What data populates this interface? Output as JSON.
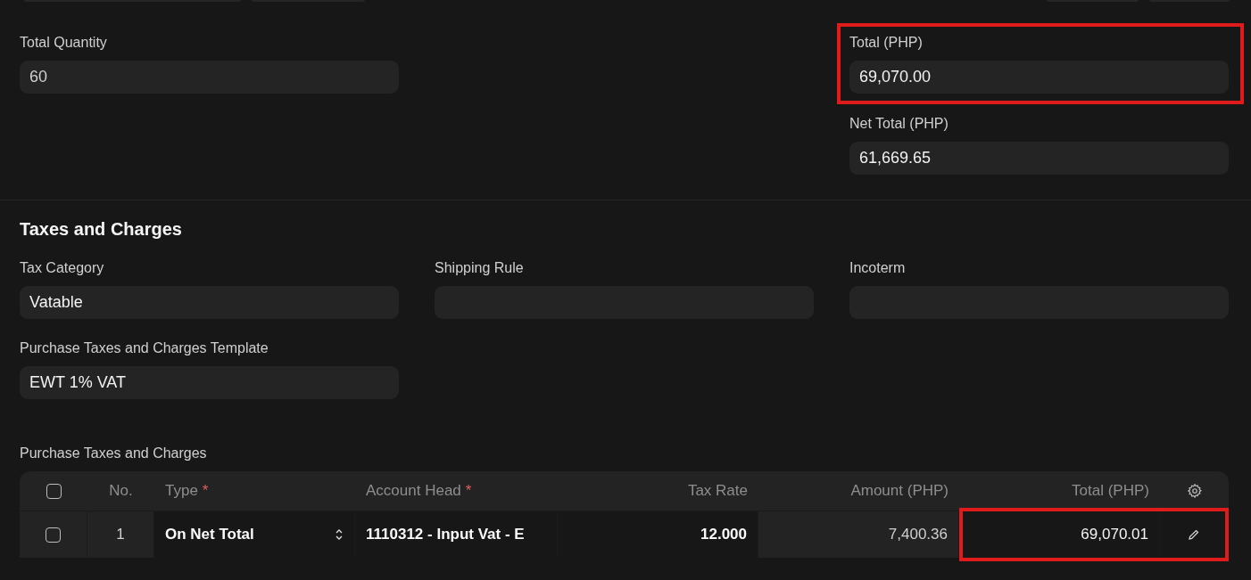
{
  "summary": {
    "total_quantity": {
      "label": "Total Quantity",
      "value": "60"
    },
    "total": {
      "label": "Total (PHP)",
      "value": "69,070.00",
      "highlighted": true
    },
    "net_total": {
      "label": "Net Total (PHP)",
      "value": "61,669.65"
    }
  },
  "taxes_section": {
    "title": "Taxes and Charges",
    "fields": [
      {
        "label": "Tax Category",
        "value": "Vatable"
      },
      {
        "label": "Shipping Rule"
      },
      {
        "label": "Incoterm"
      }
    ],
    "template": {
      "label": "Purchase Taxes and Charges Template",
      "value": "EWT 1% VAT"
    }
  },
  "table": {
    "label": "Purchase Taxes and Charges",
    "all_checked": false,
    "columns": [
      {
        "label": "No."
      },
      {
        "label": "Type",
        "required_mark": "*"
      },
      {
        "label": "Account Head",
        "required_mark": "*"
      },
      {
        "label": "Tax Rate"
      },
      {
        "label": "Amount (PHP)"
      },
      {
        "label": "Total (PHP)"
      }
    ],
    "rows": [
      {
        "checked": false,
        "no": "1",
        "type": "On Net Total",
        "account_head": "1110312 - Input Vat - E",
        "tax_rate": "12.000",
        "amount": "7,400.36",
        "total": "69,070.01",
        "total_highlighted": true
      }
    ]
  }
}
